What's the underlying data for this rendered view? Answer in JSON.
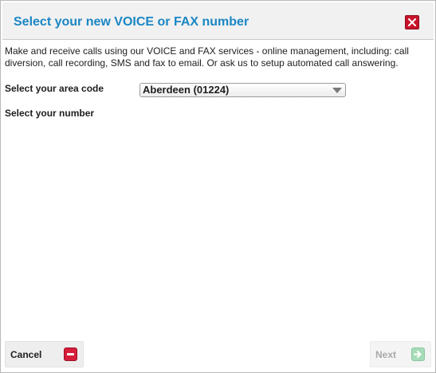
{
  "dialog": {
    "title": "Select your new VOICE or FAX number",
    "close_icon": "close-icon",
    "intro": "Make and receive calls using our VOICE and FAX services - online management, including: call diversion, call recording, SMS and fax to email. Or ask us to setup automated call answering."
  },
  "form": {
    "area_code_label": "Select your area code",
    "area_code_value": "Aberdeen (01224)",
    "number_label": "Select your number"
  },
  "footer": {
    "cancel_label": "Cancel",
    "cancel_icon": "minus-icon",
    "next_label": "Next",
    "next_icon": "arrow-right-icon",
    "next_enabled": false
  },
  "colors": {
    "title": "#1a86c4",
    "close": "#c8142a",
    "cancel_icon": "#d61d3a",
    "next_icon_disabled": "#a6dcb8"
  }
}
